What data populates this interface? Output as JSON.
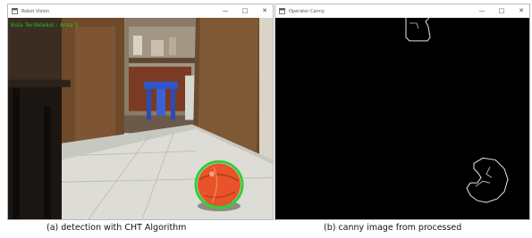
{
  "windows": {
    "left": {
      "title": "Robot Vision",
      "overlay": "Bola Terdeteksi : Area 3",
      "caption": "(a) detection with CHT Algorithm",
      "icon": "app-window-icon",
      "controls": [
        "minimize",
        "maximize",
        "close"
      ]
    },
    "right": {
      "title": "Operator Canny",
      "caption": "(b) canny image from processed",
      "icon": "app-window-icon",
      "controls": [
        "minimize",
        "maximize",
        "close"
      ]
    }
  },
  "colors": {
    "detection_circle": "#2fcf3a",
    "ball": "#e8542a",
    "overlay_text": "#1ec81e",
    "edge": "#e6e6e6"
  }
}
